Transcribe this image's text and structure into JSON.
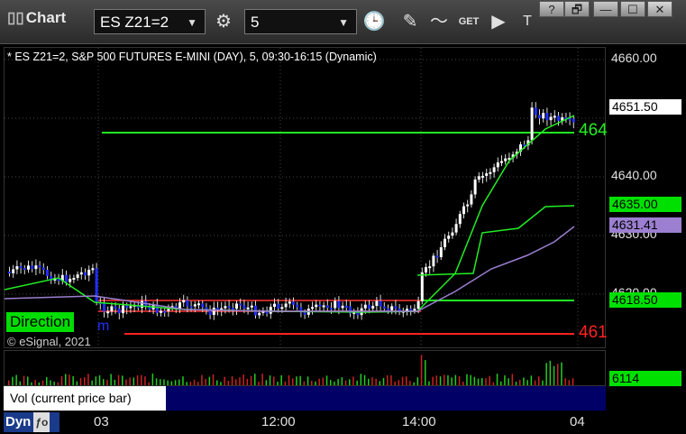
{
  "toolbar": {
    "app_title": "Chart",
    "symbol": "ES Z21=2",
    "interval": "5",
    "get_label": "GET"
  },
  "window_controls": {
    "help": "?",
    "restore": "🗗",
    "minimize": "—",
    "maximize": "☐",
    "close": "✕"
  },
  "chart": {
    "header": "* ES Z21=2, S&P 500 FUTURES E-MINI (DAY), 5, 09:30-16:15 (Dynamic)",
    "y_ticks": [
      "4660.00",
      "4640.00",
      "4630.00",
      "4620.00"
    ],
    "price_labels": [
      {
        "text": "4651.50",
        "bg": "#ffffff",
        "fg": "#000000"
      },
      {
        "text": "4635.00",
        "bg": "#00e000",
        "fg": "#000000"
      },
      {
        "text": "4631.41",
        "bg": "#9c7fd0",
        "fg": "#000000"
      },
      {
        "text": "4618.50",
        "bg": "#00e000",
        "fg": "#000000"
      }
    ],
    "line_labels": [
      {
        "text": "464",
        "color": "#22ee22"
      },
      {
        "text": "461",
        "color": "#ff2222"
      }
    ],
    "direction_label": "Direction",
    "partial_text": "m",
    "copyright": "© eSignal, 2021",
    "colors": {
      "up": "#ffffff",
      "down": "#1f2fff",
      "ma_fast": "#22ee22",
      "ma_slow": "#9c7fd0",
      "resistance": "#22ee22",
      "support": "#ff2222"
    }
  },
  "volume": {
    "label": "Vol (current price bar)",
    "close": "×",
    "value_label": "6114"
  },
  "x_axis": {
    "ticks": [
      "03",
      "12:00",
      "14:00",
      "04"
    ]
  },
  "bottom": {
    "dyn": "Dyn"
  }
}
